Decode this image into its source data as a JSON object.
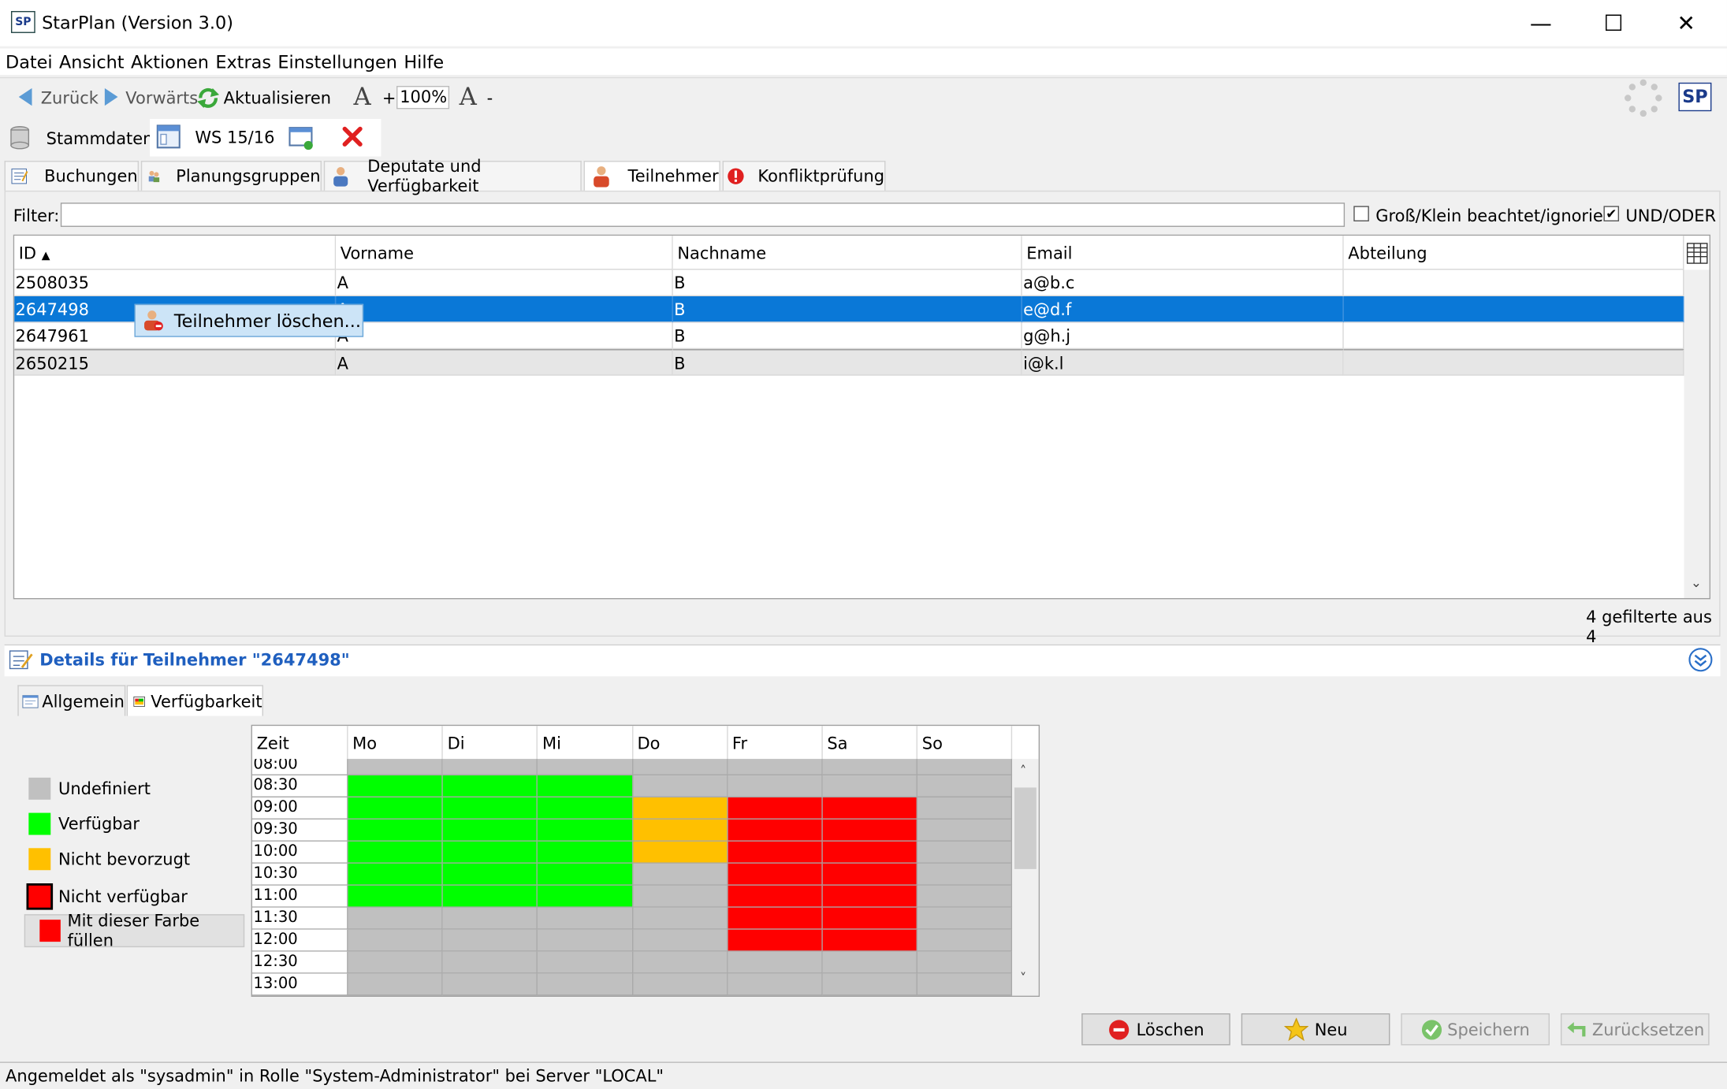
{
  "window": {
    "title": "StarPlan (Version 3.0)",
    "logo": "SP"
  },
  "menu": [
    "Datei",
    "Ansicht",
    "Aktionen",
    "Extras",
    "Einstellungen",
    "Hilfe"
  ],
  "toolbar": {
    "back": "Zurück",
    "forward": "Vorwärts",
    "refresh": "Aktualisieren",
    "zoom": "100%",
    "plus": "+",
    "minus": "-"
  },
  "doc_tabs": {
    "master": "Stammdaten",
    "semester": "WS 15/16"
  },
  "sub_tabs": [
    "Buchungen",
    "Planungsgruppen",
    "Deputate und Verfügbarkeit",
    "Teilnehmer",
    "Konfliktprüfung"
  ],
  "filter": {
    "label": "Filter:",
    "value": "",
    "case_label": "Groß/Klein beachtet/ignoriert",
    "case_checked": false,
    "andor_label": "UND/ODER",
    "andor_checked": true
  },
  "table": {
    "columns": [
      "ID",
      "Vorname",
      "Nachname",
      "Email",
      "Abteilung"
    ],
    "sort_indicator": "▲",
    "rows": [
      {
        "id": "2508035",
        "first": "A",
        "last": "B",
        "email": "a@b.c",
        "dept": ""
      },
      {
        "id": "2647498",
        "first": "A",
        "last": "B",
        "email": "e@d.f",
        "dept": ""
      },
      {
        "id": "2647961",
        "first": "A",
        "last": "B",
        "email": "g@h.j",
        "dept": ""
      },
      {
        "id": "2650215",
        "first": "A",
        "last": "B",
        "email": "i@k.l",
        "dept": ""
      }
    ],
    "selected_row": 1,
    "count_text": "4 gefilterte aus 4"
  },
  "context_menu": {
    "item": "Teilnehmer löschen..."
  },
  "details": {
    "title": "Details für Teilnehmer \"2647498\"",
    "tabs": [
      "Allgemein",
      "Verfügbarkeit"
    ]
  },
  "legend": [
    {
      "label": "Undefiniert",
      "color": "#c0c0c0"
    },
    {
      "label": "Verfügbar",
      "color": "#00ff00"
    },
    {
      "label": "Nicht bevorzugt",
      "color": "#ffc000"
    },
    {
      "label": "Nicht verfügbar",
      "color": "#ff0000"
    }
  ],
  "fill_button": "Mit dieser Farbe füllen",
  "availability": {
    "header_time": "Zeit",
    "days": [
      "Mo",
      "Di",
      "Mi",
      "Do",
      "Fr",
      "Sa",
      "So"
    ],
    "times": [
      "08:00",
      "08:30",
      "09:00",
      "09:30",
      "10:00",
      "10:30",
      "11:00",
      "11:30",
      "12:00",
      "12:30",
      "13:00"
    ],
    "cells": [
      [
        "U",
        "U",
        "U",
        "U",
        "U",
        "U",
        "U"
      ],
      [
        "G",
        "G",
        "G",
        "U",
        "U",
        "U",
        "U"
      ],
      [
        "G",
        "G",
        "G",
        "O",
        "R",
        "R",
        "U"
      ],
      [
        "G",
        "G",
        "G",
        "O",
        "R",
        "R",
        "U"
      ],
      [
        "G",
        "G",
        "G",
        "O",
        "R",
        "R",
        "U"
      ],
      [
        "G",
        "G",
        "G",
        "U",
        "R",
        "R",
        "U"
      ],
      [
        "G",
        "G",
        "G",
        "U",
        "R",
        "R",
        "U"
      ],
      [
        "U",
        "U",
        "U",
        "U",
        "R",
        "R",
        "U"
      ],
      [
        "U",
        "U",
        "U",
        "U",
        "R",
        "R",
        "U"
      ],
      [
        "U",
        "U",
        "U",
        "U",
        "U",
        "U",
        "U"
      ],
      [
        "U",
        "U",
        "U",
        "U",
        "U",
        "U",
        "U"
      ]
    ],
    "colors": {
      "U": "#c0c0c0",
      "G": "#00ff00",
      "O": "#ffc000",
      "R": "#ff0000"
    }
  },
  "buttons": {
    "delete": "Löschen",
    "new": "Neu",
    "save": "Speichern",
    "reset": "Zurücksetzen"
  },
  "status": "Angemeldet als \"sysadmin\" in Rolle \"System-Administrator\" bei Server \"LOCAL\""
}
